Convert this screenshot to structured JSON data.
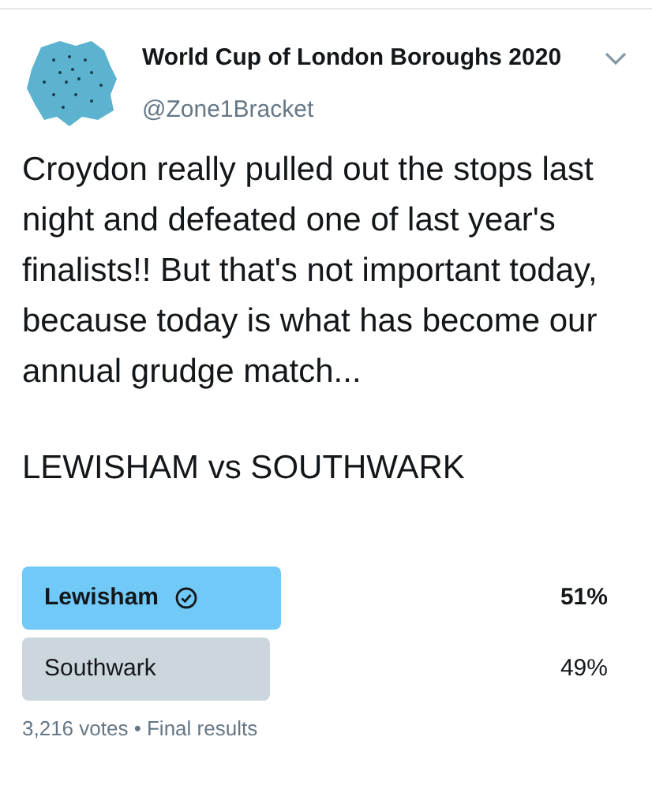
{
  "author": {
    "name": "World Cup of London Boroughs 2020",
    "handle": "@Zone1Bracket"
  },
  "tweet_text": "Croydon really pulled out the stops last night and defeated one of last year's finalists!! But that's not important today, because today is what has become our annual grudge match...",
  "headline": "LEWISHAM vs SOUTHWARK",
  "poll": {
    "options": [
      {
        "label": "Lewisham",
        "percent": "51%",
        "selected": true
      },
      {
        "label": "Southwark",
        "percent": "49%",
        "selected": false
      }
    ],
    "summary": "3,216 votes • Final results"
  }
}
